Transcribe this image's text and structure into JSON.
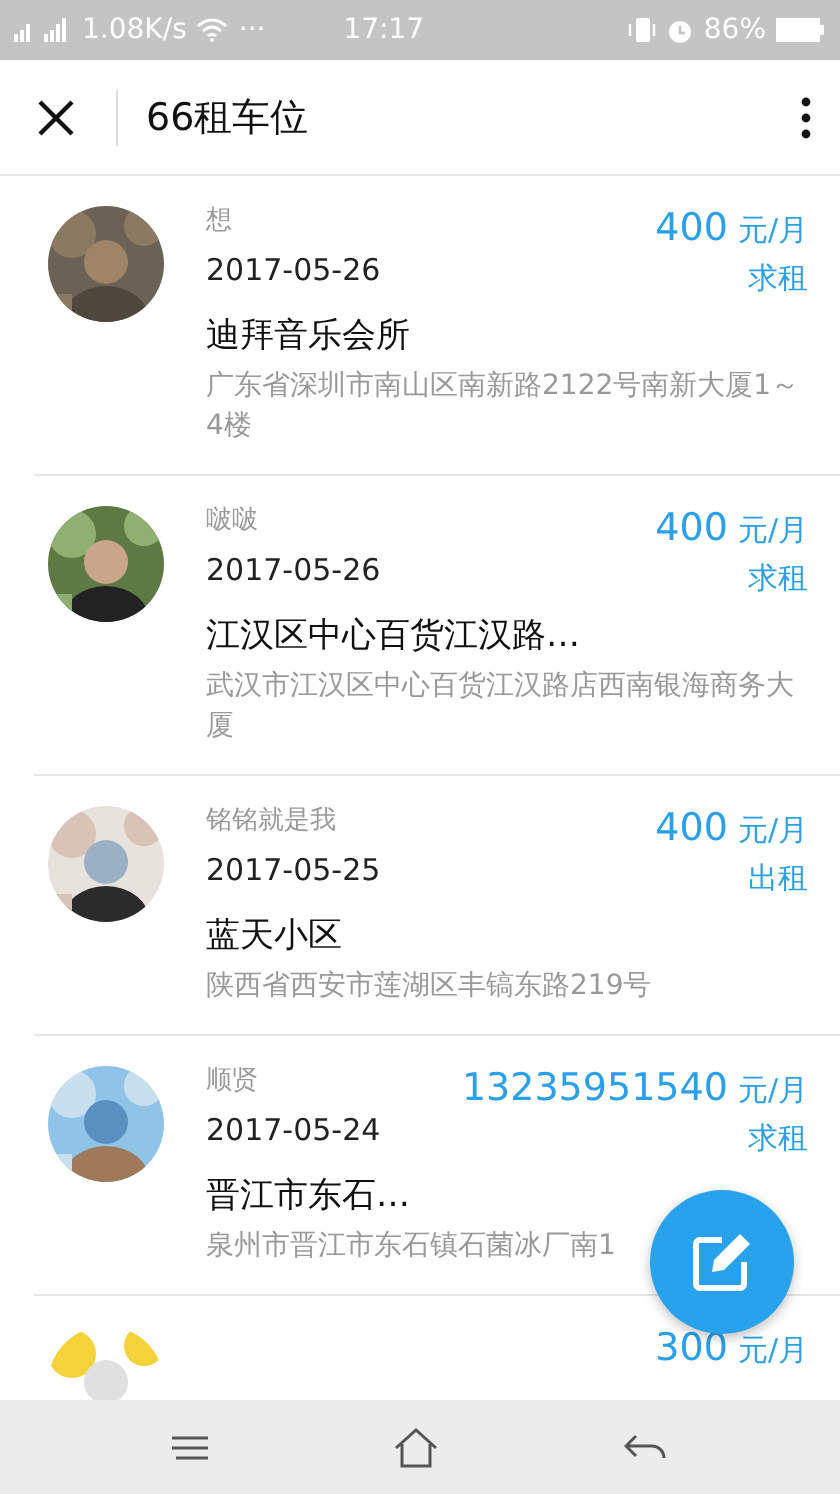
{
  "status_bar": {
    "speed": "1.08K/s",
    "more": "···",
    "time": "17:17",
    "battery": "86%"
  },
  "header": {
    "title": "66租车位"
  },
  "listings": [
    {
      "name": "想",
      "date": "2017-05-26",
      "price": "400",
      "unit": "元/月",
      "type": "求租",
      "title": "迪拜音乐会所",
      "address": "广东省深圳市南山区南新路2122号南新大厦1～4楼"
    },
    {
      "name": "啵啵",
      "date": "2017-05-26",
      "price": "400",
      "unit": "元/月",
      "type": "求租",
      "title": "江汉区中心百货江汉路…",
      "address": "武汉市江汉区中心百货江汉路店西南银海商务大厦"
    },
    {
      "name": "铭铭就是我",
      "date": "2017-05-25",
      "price": "400",
      "unit": "元/月",
      "type": "出租",
      "title": "蓝天小区",
      "address": "陕西省西安市莲湖区丰镐东路219号"
    },
    {
      "name": "顺贤",
      "date": "2017-05-24",
      "price": "13235951540",
      "unit": "元/月",
      "type": "求租",
      "title": "晋江市东石…",
      "address": "泉州市晋江市东石镇石菌冰厂南1"
    },
    {
      "price": "300",
      "unit": "元/月"
    }
  ]
}
